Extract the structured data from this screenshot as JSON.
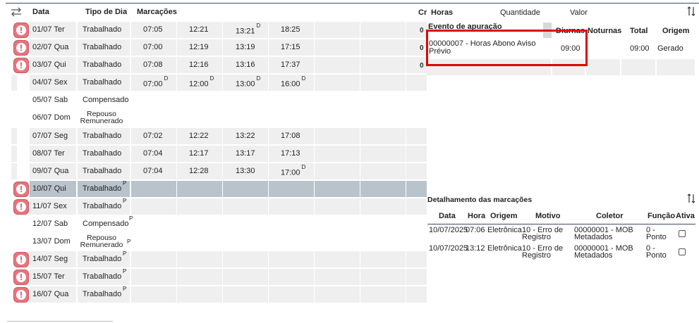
{
  "left_header": {
    "date": "Data",
    "type": "Tipo de Dia",
    "marks": "Marcações"
  },
  "rows": [
    {
      "date": "01/07 Ter",
      "type": "Trabalhado",
      "alert": true,
      "marks": [
        "07:05",
        "12:21",
        "13:21",
        "18:25"
      ],
      "mark_flags": [
        "",
        "",
        "D",
        ""
      ]
    },
    {
      "date": "02/07 Qua",
      "type": "Trabalhado",
      "alert": true,
      "marks": [
        "07:00",
        "12:19",
        "13:19",
        "17:15"
      ],
      "mark_flags": [
        "",
        "",
        "",
        ""
      ]
    },
    {
      "date": "03/07 Qui",
      "type": "Trabalhado",
      "alert": true,
      "marks": [
        "07:08",
        "12:16",
        "13:16",
        "17:37"
      ],
      "mark_flags": [
        "",
        "",
        "",
        ""
      ]
    },
    {
      "date": "04/07 Sex",
      "type": "Trabalhado",
      "alert": false,
      "marks": [
        "07:00",
        "12:00",
        "13:00",
        "16:00"
      ],
      "mark_flags": [
        "D",
        "D",
        "D",
        "D"
      ]
    },
    {
      "date": "05/07 Sab",
      "type": "Compensado",
      "alert": false,
      "marks": [],
      "mark_flags": []
    },
    {
      "date": "06/07 Dom",
      "type": "Repouso Remunerado",
      "alert": false,
      "marks": [],
      "mark_flags": []
    },
    {
      "date": "07/07 Seg",
      "type": "Trabalhado",
      "alert": false,
      "marks": [
        "07:02",
        "12:22",
        "13:22",
        "17:08"
      ],
      "mark_flags": [
        "",
        "",
        "",
        ""
      ]
    },
    {
      "date": "08/07 Ter",
      "type": "Trabalhado",
      "alert": false,
      "marks": [
        "07:04",
        "12:17",
        "13:17",
        "17:13"
      ],
      "mark_flags": [
        "",
        "",
        "",
        ""
      ]
    },
    {
      "date": "09/07 Qua",
      "type": "Trabalhado",
      "alert": false,
      "marks": [
        "07:04",
        "12:28",
        "13:30",
        "17:00"
      ],
      "mark_flags": [
        "",
        "",
        "",
        "D"
      ]
    },
    {
      "date": "10/07 Qui",
      "type": "Trabalhado",
      "alert": true,
      "selected": true,
      "type_flag": "P",
      "marks": [],
      "mark_flags": []
    },
    {
      "date": "11/07 Sex",
      "type": "Trabalhado",
      "alert": true,
      "type_flag": "P",
      "marks": [],
      "mark_flags": []
    },
    {
      "date": "12/07 Sab",
      "type": "Compensado",
      "alert": false,
      "type_flag": "P",
      "marks": [],
      "mark_flags": []
    },
    {
      "date": "13/07 Dom",
      "type": "Repouso Remunerado",
      "alert": false,
      "type_flag": "P",
      "marks": [],
      "mark_flags": []
    },
    {
      "date": "14/07 Seg",
      "type": "Trabalhado",
      "alert": true,
      "type_flag": "P",
      "marks": [],
      "mark_flags": []
    },
    {
      "date": "15/07 Ter",
      "type": "Trabalhado",
      "alert": true,
      "type_flag": "P",
      "marks": [],
      "mark_flags": []
    },
    {
      "date": "16/07 Qua",
      "type": "Trabalhado",
      "alert": true,
      "type_flag": "P",
      "marks": [],
      "mark_flags": []
    }
  ],
  "right_header": {
    "cr": "Cr",
    "hours": "Horas",
    "quantity": "Quantidade",
    "value": "Valor"
  },
  "stub_letters": [
    "0",
    "0",
    "0"
  ],
  "event": {
    "headers": {
      "event": "Evento de apuração",
      "day": "Diurnas",
      "night": "Noturnas",
      "total": "Total",
      "origin": "Origem"
    },
    "row": {
      "event": "00000007 - Horas Abono Aviso Prévio",
      "day": "09:00",
      "night": "",
      "total": "09:00",
      "origin": "Gerado"
    }
  },
  "details": {
    "title": "Detalhamento das marcações",
    "headers": {
      "date": "Data",
      "time": "Hora",
      "origin": "Origem",
      "reason": "Motivo",
      "collector": "Coletor",
      "function": "Função",
      "active": "Ativa"
    },
    "rows": [
      {
        "date": "10/07/2025",
        "time": "07:06",
        "origin": "Eletrônica",
        "reason": "10 - Erro de Registro",
        "collector": "00000001 - MOB Metadados",
        "function": "0 - Ponto",
        "active": false
      },
      {
        "date": "10/07/2025",
        "time": "13:12",
        "origin": "Eletrônica",
        "reason": "10 - Erro de Registro",
        "collector": "00000001 - MOB Metadados",
        "function": "0 - Ponto",
        "active": false
      }
    ]
  },
  "colors": {
    "alert": "#e8747e",
    "selected_row": "#b9c3cb",
    "highlight_box": "#e10000",
    "cell_bg": "#efefef"
  }
}
